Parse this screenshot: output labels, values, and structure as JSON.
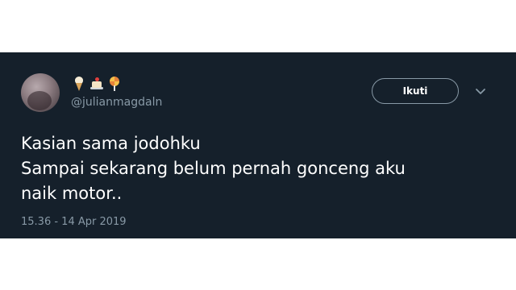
{
  "tweet": {
    "emojis": [
      "ice-cream-icon",
      "cake-icon",
      "lollipop-icon"
    ],
    "username": "@julianmagdaln",
    "follow_label": "Ikuti",
    "text_lines": [
      "Kasian sama jodohku",
      "Sampai sekarang belum pernah gonceng aku",
      "naik motor.."
    ],
    "timestamp": "15.36 - 14 Apr 2019"
  },
  "colors": {
    "card_background": "#15202b",
    "secondary_text": "#8899a6",
    "primary_text": "#ffffff",
    "page_background": "#ffffff"
  }
}
